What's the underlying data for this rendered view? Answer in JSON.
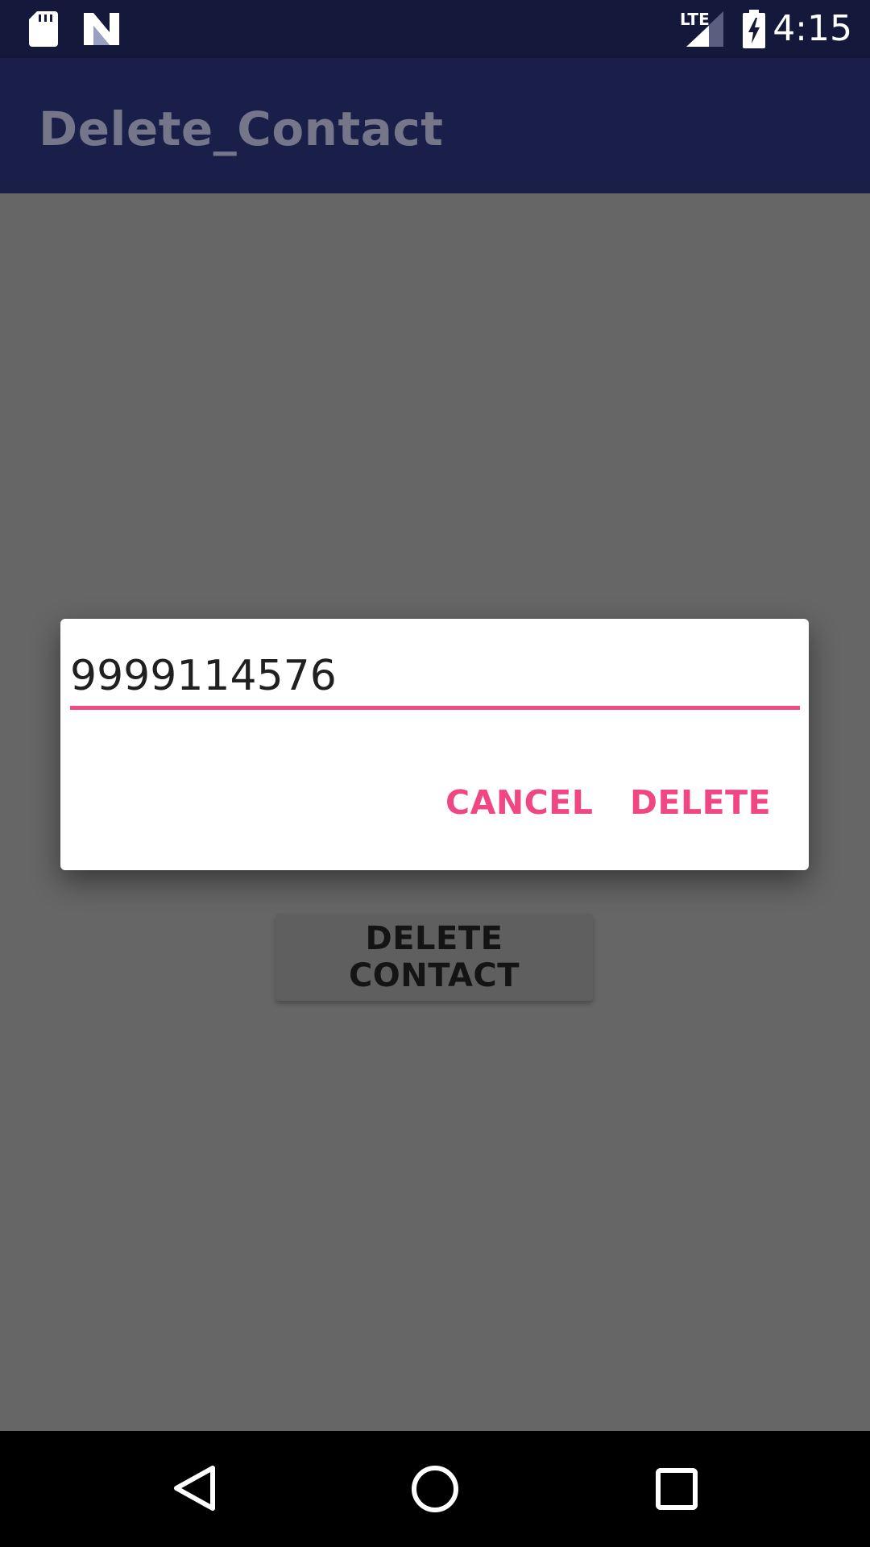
{
  "status_bar": {
    "time": "4:15",
    "network_label": "LTE",
    "icons": [
      "sd-card-icon",
      "n-logo-icon",
      "signal-icon",
      "battery-charging-icon"
    ]
  },
  "app_bar": {
    "title": "Delete_Contact"
  },
  "main": {
    "delete_contact_button": "DELETE CONTACT"
  },
  "dialog": {
    "input_value": "9999114576",
    "cancel_label": "CANCEL",
    "delete_label": "DELETE",
    "accent_color": "#f04684"
  },
  "nav_bar": {
    "icons": [
      "back-icon",
      "home-icon",
      "recents-icon"
    ]
  }
}
